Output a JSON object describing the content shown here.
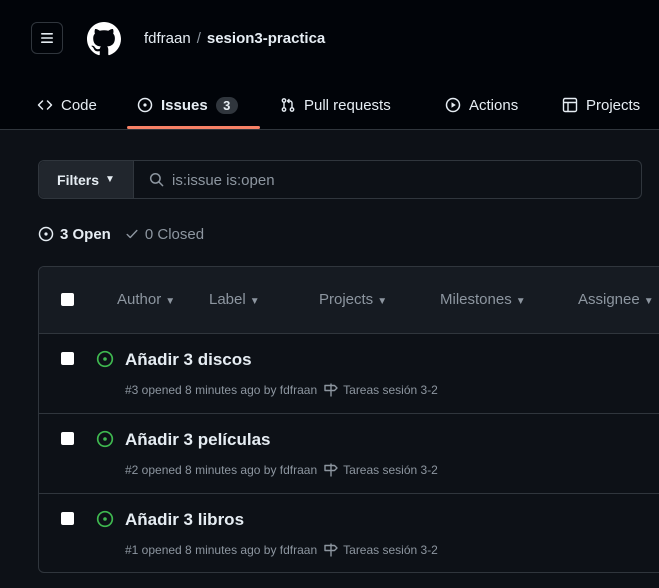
{
  "header": {
    "owner": "fdfraan",
    "separator": "/",
    "repo": "sesion3-practica"
  },
  "tabs": [
    {
      "label": "Code",
      "icon": "code-icon"
    },
    {
      "label": "Issues",
      "icon": "issue-opened-icon",
      "counter": "3",
      "active": true
    },
    {
      "label": "Pull requests",
      "icon": "git-pull-request-icon"
    },
    {
      "label": "Actions",
      "icon": "play-icon"
    },
    {
      "label": "Projects",
      "icon": "table-icon"
    }
  ],
  "filters": {
    "button_label": "Filters",
    "search_value": "is:issue is:open"
  },
  "states": {
    "open_label": "3 Open",
    "closed_label": "0 Closed"
  },
  "list_header": {
    "author": "Author",
    "label": "Label",
    "projects": "Projects",
    "milestones": "Milestones",
    "assignee": "Assignee"
  },
  "issues": [
    {
      "title": "Añadir 3 discos",
      "meta": "#3 opened 8 minutes ago by fdfraan",
      "milestone": "Tareas sesión 3-2"
    },
    {
      "title": "Añadir 3 películas",
      "meta": "#2 opened 8 minutes ago by fdfraan",
      "milestone": "Tareas sesión 3-2"
    },
    {
      "title": "Añadir 3 libros",
      "meta": "#1 opened 8 minutes ago by fdfraan",
      "milestone": "Tareas sesión 3-2"
    }
  ],
  "colors": {
    "background": "#0d1117",
    "header_background": "#010409",
    "border": "#30363d",
    "open_green": "#3fb950",
    "tab_underline": "#f78166",
    "muted_text": "#8d96a0"
  }
}
